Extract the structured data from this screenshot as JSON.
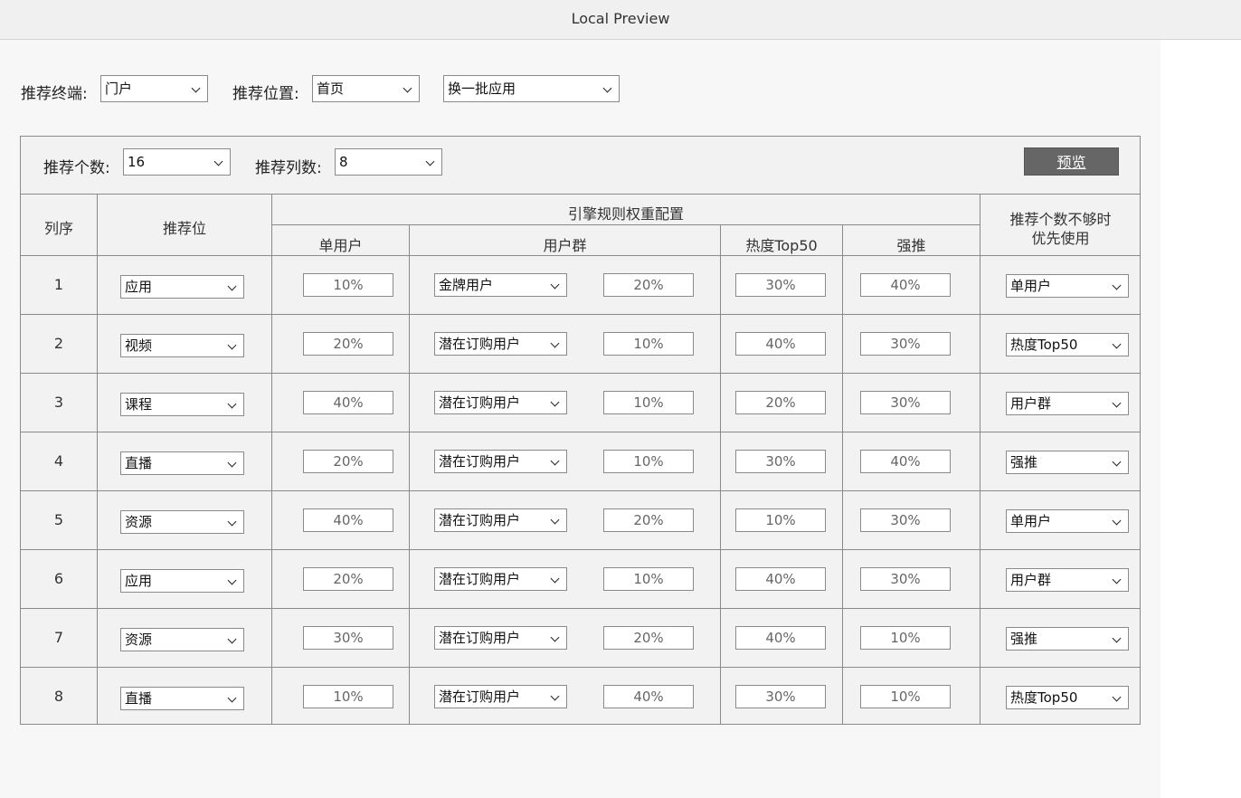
{
  "window": {
    "title": "Local Preview"
  },
  "filters": {
    "terminal_label": "推荐终端:",
    "terminal_value": "门户",
    "position_label": "推荐位置:",
    "position_value": "首页",
    "batch_value": "换一批应用"
  },
  "config": {
    "count_label": "推荐个数:",
    "count_value": "16",
    "columns_label": "推荐列数:",
    "columns_value": "8",
    "preview_label": "预览"
  },
  "table": {
    "headers": {
      "order": "列序",
      "slot": "推荐位",
      "engine": "引擎规则权重配置",
      "single_user": "单用户",
      "user_group": "用户群",
      "hot_top50": "热度Top50",
      "push": "强推",
      "fallback_line1": "推荐个数不够时",
      "fallback_line2": "优先使用"
    },
    "rows": [
      {
        "order": "1",
        "slot": "应用",
        "single": "10%",
        "group": "金牌用户",
        "group_pct": "20%",
        "hot": "30%",
        "push": "40%",
        "fallback": "单用户"
      },
      {
        "order": "2",
        "slot": "视频",
        "single": "20%",
        "group": "潜在订购用户",
        "group_pct": "10%",
        "hot": "40%",
        "push": "30%",
        "fallback": "热度Top50"
      },
      {
        "order": "3",
        "slot": "课程",
        "single": "40%",
        "group": "潜在订购用户",
        "group_pct": "10%",
        "hot": "20%",
        "push": "30%",
        "fallback": "用户群"
      },
      {
        "order": "4",
        "slot": "直播",
        "single": "20%",
        "group": "潜在订购用户",
        "group_pct": "10%",
        "hot": "30%",
        "push": "40%",
        "fallback": "强推"
      },
      {
        "order": "5",
        "slot": "资源",
        "single": "40%",
        "group": "潜在订购用户",
        "group_pct": "20%",
        "hot": "10%",
        "push": "30%",
        "fallback": "单用户"
      },
      {
        "order": "6",
        "slot": "应用",
        "single": "20%",
        "group": "潜在订购用户",
        "group_pct": "10%",
        "hot": "40%",
        "push": "30%",
        "fallback": "用户群"
      },
      {
        "order": "7",
        "slot": "资源",
        "single": "30%",
        "group": "潜在订购用户",
        "group_pct": "20%",
        "hot": "40%",
        "push": "10%",
        "fallback": "强推"
      },
      {
        "order": "8",
        "slot": "直播",
        "single": "10%",
        "group": "潜在订购用户",
        "group_pct": "40%",
        "hot": "30%",
        "push": "10%",
        "fallback": "热度Top50"
      }
    ]
  }
}
